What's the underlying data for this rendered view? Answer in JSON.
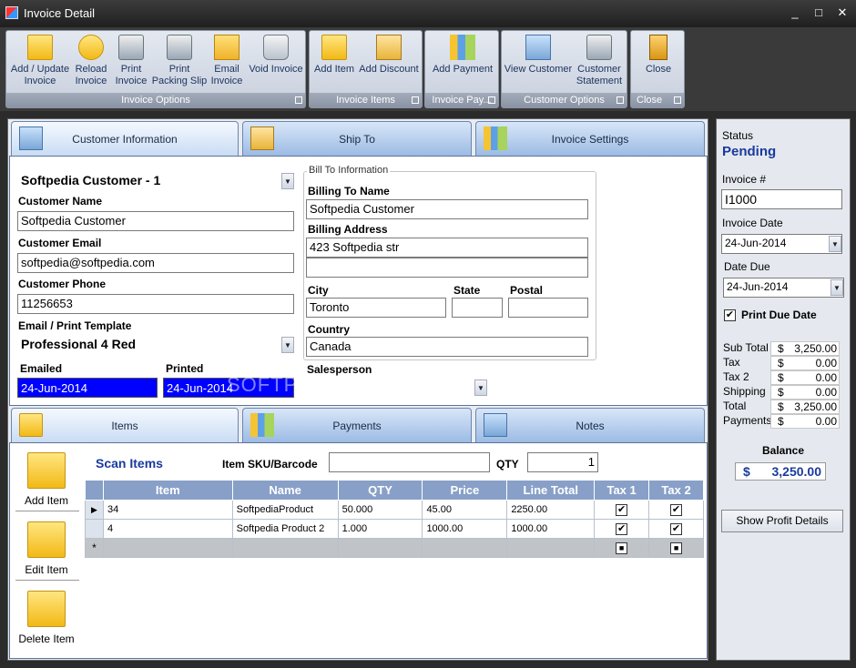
{
  "window": {
    "title": "Invoice Detail",
    "controls": [
      "_",
      "□",
      "✕"
    ]
  },
  "ribbon": {
    "groups": [
      {
        "label": "Invoice Options",
        "buttons": [
          {
            "l1": "Add / Update",
            "l2": "Invoice"
          },
          {
            "l1": "Reload",
            "l2": "Invoice"
          },
          {
            "l1": "Print",
            "l2": "Invoice"
          },
          {
            "l1": "Print",
            "l2": "Packing Slip"
          },
          {
            "l1": "Email",
            "l2": "Invoice"
          },
          {
            "l1": "Void Invoice",
            "l2": ""
          }
        ]
      },
      {
        "label": "Invoice Items",
        "buttons": [
          {
            "l1": "Add Item",
            "l2": ""
          },
          {
            "l1": "Add Discount",
            "l2": ""
          }
        ]
      },
      {
        "label": "Invoice Pay...",
        "buttons": [
          {
            "l1": "Add Payment",
            "l2": ""
          }
        ]
      },
      {
        "label": "Customer Options",
        "buttons": [
          {
            "l1": "View Customer",
            "l2": ""
          },
          {
            "l1": "Customer",
            "l2": "Statement"
          }
        ]
      },
      {
        "label": "Close",
        "buttons": [
          {
            "l1": "Close",
            "l2": ""
          }
        ]
      }
    ]
  },
  "tabs_top": [
    "Customer Information",
    "Ship To",
    "Invoice Settings"
  ],
  "customer": {
    "selected": "Softpedia Customer - 1",
    "name_label": "Customer Name",
    "name": "Softpedia Customer",
    "email_label": "Customer Email",
    "email": "softpedia@softpedia.com",
    "phone_label": "Customer Phone",
    "phone": "11256653",
    "template_label": "Email / Print Template",
    "template": "Professional 4 Red",
    "emailed_label": "Emailed",
    "emailed": "24-Jun-2014",
    "printed_label": "Printed",
    "printed": "24-Jun-2014",
    "salesperson_label": "Salesperson",
    "salesperson": ""
  },
  "billto": {
    "legend": "Bill To Information",
    "name_label": "Billing To Name",
    "name": "Softpedia Customer",
    "address_label": "Billing Address",
    "address1": "423 Softpedia str",
    "address2": "",
    "city_label": "City",
    "city": "Toronto",
    "state_label": "State",
    "state": "",
    "postal_label": "Postal",
    "postal": "",
    "country_label": "Country",
    "country": "Canada"
  },
  "watermark": "SOFTPEDIA",
  "tabs_bottom": [
    "Items",
    "Payments",
    "Notes"
  ],
  "items": {
    "side_buttons": [
      "Add Item",
      "Edit Item",
      "Delete Item"
    ],
    "scan_label": "Scan Items",
    "sku_label": "Item SKU/Barcode",
    "sku": "",
    "qty_label": "QTY",
    "qty": "1",
    "columns": [
      "Item",
      "Name",
      "QTY",
      "Price",
      "Line Total",
      "Tax 1",
      "Tax 2"
    ],
    "rows": [
      {
        "marker": "▶",
        "item": "34",
        "name": "SoftpediaProduct",
        "qty": "50.000",
        "price": "45.00",
        "total": "2250.00",
        "tax1": "✔",
        "tax2": "✔"
      },
      {
        "marker": "",
        "item": "4",
        "name": "Softpedia Product 2",
        "qty": "1.000",
        "price": "1000.00",
        "total": "1000.00",
        "tax1": "✔",
        "tax2": "✔"
      }
    ],
    "new_row": {
      "marker": "*",
      "tax1": "■",
      "tax2": "■"
    }
  },
  "side": {
    "status_label": "Status",
    "status": "Pending",
    "invoice_no_label": "Invoice #",
    "invoice_no": "I1000",
    "invoice_date_label": "Invoice Date",
    "invoice_date": "24-Jun-2014",
    "date_due_label": "Date Due",
    "date_due": "24-Jun-2014",
    "print_due_date_label": "Print Due Date",
    "print_due_date_check": "✔",
    "summary": [
      {
        "k": "Sub Total",
        "d": "$",
        "v": "3,250.00"
      },
      {
        "k": "Tax",
        "d": "$",
        "v": "0.00"
      },
      {
        "k": "Tax 2",
        "d": "$",
        "v": "0.00"
      },
      {
        "k": "Shipping",
        "d": "$",
        "v": "0.00"
      },
      {
        "k": "Total",
        "d": "$",
        "v": "3,250.00"
      },
      {
        "k": "Payments",
        "d": "$",
        "v": "0.00"
      }
    ],
    "balance_label": "Balance",
    "balance_currency": "$",
    "balance": "3,250.00",
    "profit_button": "Show Profit Details"
  },
  "colors": {
    "accent": "#1a3a9e",
    "selection": "#0000ff",
    "grid_header": "#88a0c8"
  }
}
